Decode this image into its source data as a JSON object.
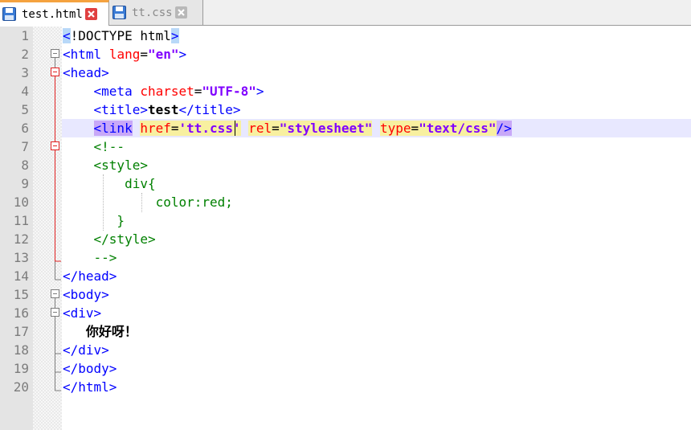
{
  "tabs": [
    {
      "label": "test.html",
      "icon": "save-icon",
      "active": true
    },
    {
      "label": "tt.css",
      "icon": "save-icon",
      "active": false
    }
  ],
  "colors": {
    "tag": "#0000ff",
    "attribute": "#ff0000",
    "string": "#8000ff",
    "comment": "#008000",
    "current_line": "#e8e8ff",
    "brace_match": "#b8d8f8",
    "tag_match": "#c8a8f8",
    "attr_match": "#f8f0a0",
    "tab_accent": "#f5a23f",
    "close_active": "#e04040"
  },
  "editor": {
    "line_numbers": [
      "1",
      "2",
      "3",
      "4",
      "5",
      "6",
      "7",
      "8",
      "9",
      "10",
      "11",
      "12",
      "13",
      "14",
      "15",
      "16",
      "17",
      "18",
      "19",
      "20"
    ],
    "lines": {
      "l1": {
        "open": "<",
        "text": "!DOCTYPE html",
        "close": ">"
      },
      "l2": {
        "open_tag": "<html",
        "attr": "lang",
        "eq": "=",
        "val": "\"en\"",
        "close": ">"
      },
      "l3": {
        "text": "<head>"
      },
      "l4": {
        "indent": "    ",
        "open_tag": "<meta",
        "attr": "charset",
        "eq": "=",
        "val": "\"UTF-8\"",
        "close": ">"
      },
      "l5": {
        "indent": "    ",
        "open_tag": "<title>",
        "content": "test",
        "close_tag": "</title>"
      },
      "l6": {
        "indent": "    ",
        "open_tag": "<link",
        "sp1": " ",
        "attr1": "href",
        "eq1": "=",
        "val1": "'tt.css'",
        "sp2": " ",
        "attr2": "rel",
        "eq2": "=",
        "val2": "\"stylesheet\"",
        "sp3": " ",
        "attr3": "type",
        "eq3": "=",
        "val3": "\"text/css\"",
        "close": "/>"
      },
      "l7": {
        "text": "    <!--"
      },
      "l8": {
        "text": "    <style>"
      },
      "l9": {
        "text": "        div{"
      },
      "l10": {
        "text": "            color:red;"
      },
      "l11": {
        "text": "       }"
      },
      "l12": {
        "text": "    </style>"
      },
      "l13": {
        "text": "    -->"
      },
      "l14": {
        "text": "</head>"
      },
      "l15": {
        "text": "<body>"
      },
      "l16": {
        "text": "<div>"
      },
      "l17": {
        "indent": "   ",
        "content": "你好呀！"
      },
      "l18": {
        "text": "</div>"
      },
      "l19": {
        "text": "</body>"
      },
      "l20": {
        "text": "</html>"
      }
    }
  }
}
